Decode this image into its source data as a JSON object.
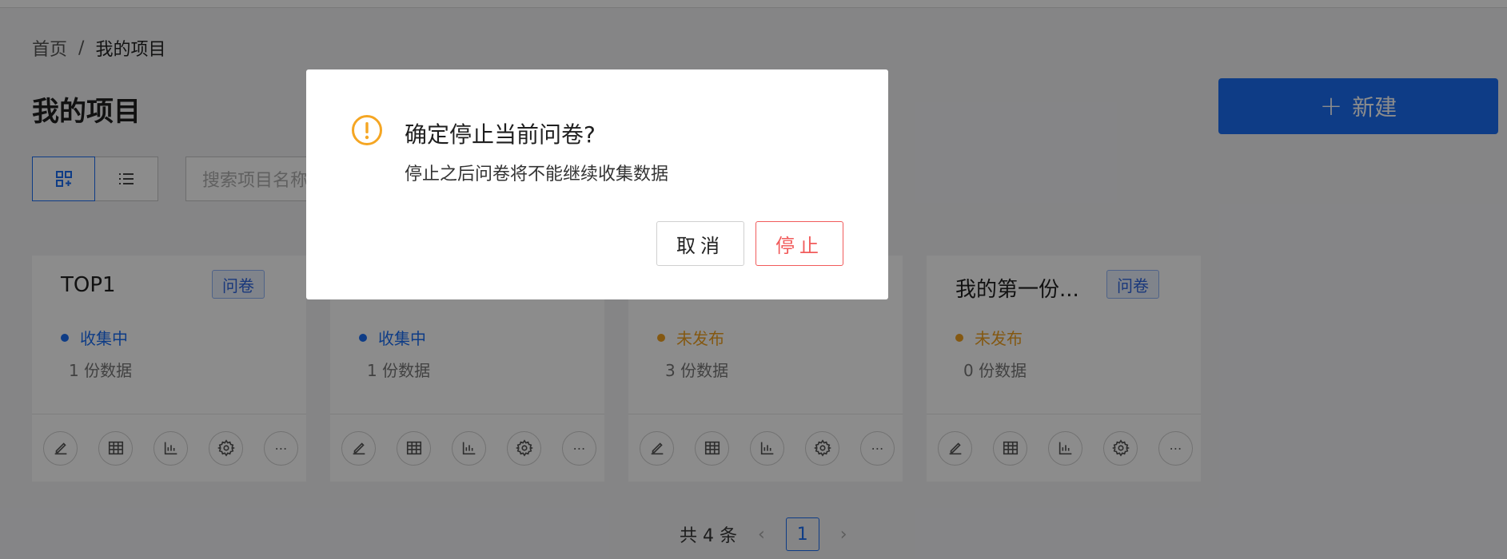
{
  "breadcrumb": {
    "home": "首页",
    "separator": "/",
    "current": "我的项目"
  },
  "page_title": "我的项目",
  "new_button": {
    "icon": "plus-icon",
    "label": "新建"
  },
  "view_toggle": {
    "grid_icon": "grid-view-icon",
    "list_icon": "list-view-icon"
  },
  "search": {
    "placeholder": "搜索项目名称"
  },
  "cards": [
    {
      "name": "TOP1",
      "tag": "问卷",
      "status": "收集中",
      "status_color": "#1a6ef5",
      "count": "1 份数据"
    },
    {
      "name": "",
      "tag": "",
      "status": "收集中",
      "status_color": "#1a6ef5",
      "count": "1 份数据"
    },
    {
      "name": "",
      "tag": "",
      "status": "未发布",
      "status_color": "#f0a020",
      "count": "3 份数据"
    },
    {
      "name": "我的第一份...",
      "tag": "问卷",
      "status": "未发布",
      "status_color": "#f0a020",
      "count": "0 份数据"
    }
  ],
  "card_actions": [
    "edit-icon",
    "table-icon",
    "chart-icon",
    "settings-icon",
    "more-icon"
  ],
  "pagination": {
    "total": "共 4 条",
    "current_page": "1"
  },
  "modal": {
    "icon": "warning-icon",
    "title": "确定停止当前问卷?",
    "body": "停止之后问卷将不能继续收集数据",
    "cancel_label": "取消",
    "stop_label": "停止"
  },
  "colors": {
    "primary": "#1a6ef5",
    "danger": "#f15b5b",
    "warning": "#f5a623",
    "collecting": "#1a6ef5",
    "unpublished": "#f0a020"
  }
}
